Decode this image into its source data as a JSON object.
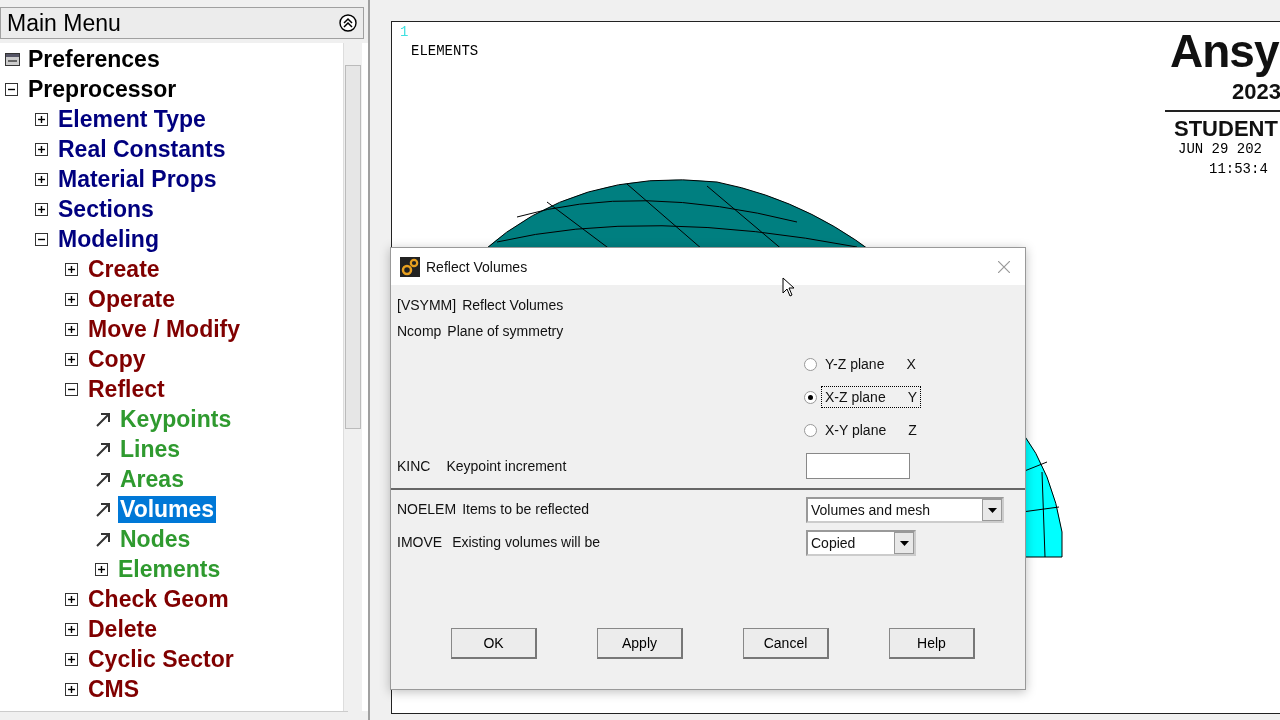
{
  "main_menu": {
    "title": "Main Menu",
    "items": [
      {
        "label": "Preferences",
        "kind": "settings",
        "selected": false
      },
      {
        "label": "Preprocessor",
        "kind": "node",
        "expanded": true,
        "selected": false,
        "children": [
          {
            "label": "Element Type",
            "kind": "node",
            "expanded": false,
            "selected": false
          },
          {
            "label": "Real Constants",
            "kind": "node",
            "expanded": false,
            "selected": false
          },
          {
            "label": "Material Props",
            "kind": "node",
            "expanded": false,
            "selected": false
          },
          {
            "label": "Sections",
            "kind": "node",
            "expanded": false,
            "selected": false
          },
          {
            "label": "Modeling",
            "kind": "node",
            "expanded": true,
            "selected": false,
            "children": [
              {
                "label": "Create",
                "kind": "node",
                "expanded": false,
                "selected": false
              },
              {
                "label": "Operate",
                "kind": "node",
                "expanded": false,
                "selected": false
              },
              {
                "label": "Move / Modify",
                "kind": "node",
                "expanded": false,
                "selected": false
              },
              {
                "label": "Copy",
                "kind": "node",
                "expanded": false,
                "selected": false
              },
              {
                "label": "Reflect",
                "kind": "node",
                "expanded": true,
                "selected": false,
                "children": [
                  {
                    "label": "Keypoints",
                    "kind": "action",
                    "selected": false
                  },
                  {
                    "label": "Lines",
                    "kind": "action",
                    "selected": false
                  },
                  {
                    "label": "Areas",
                    "kind": "action",
                    "selected": false
                  },
                  {
                    "label": "Volumes",
                    "kind": "action",
                    "selected": true
                  },
                  {
                    "label": "Nodes",
                    "kind": "action",
                    "selected": false
                  },
                  {
                    "label": "Elements",
                    "kind": "node",
                    "expanded": false,
                    "selected": false
                  }
                ]
              },
              {
                "label": "Check Geom",
                "kind": "node",
                "expanded": false,
                "selected": false
              },
              {
                "label": "Delete",
                "kind": "node",
                "expanded": false,
                "selected": false
              },
              {
                "label": "Cyclic Sector",
                "kind": "node",
                "expanded": false,
                "selected": false
              },
              {
                "label": "CMS",
                "kind": "node",
                "expanded": false,
                "selected": false
              }
            ]
          }
        ]
      }
    ]
  },
  "graphics": {
    "window_number": "1",
    "label": "ELEMENTS",
    "logo": {
      "brand": "Ansy",
      "version": "2023",
      "edition": "STUDENT"
    },
    "date": "JUN 29 202",
    "time": "11:53:4"
  },
  "dialog": {
    "title": "Reflect Volumes",
    "header": {
      "code": "[VSYMM]",
      "label": "Reflect Volumes"
    },
    "ncomp": {
      "code": "Ncomp",
      "label": "Plane of symmetry",
      "options": [
        {
          "label": "Y-Z plane",
          "axis": "X",
          "selected": false
        },
        {
          "label": "X-Z plane",
          "axis": "Y",
          "selected": true
        },
        {
          "label": "X-Y plane",
          "axis": "Z",
          "selected": false
        }
      ]
    },
    "kinc": {
      "code": "KINC",
      "label": "Keypoint increment"
    },
    "noelem": {
      "code": "NOELEM",
      "label": "Items to be reflected",
      "value": "Volumes and mesh"
    },
    "imove": {
      "code": "IMOVE",
      "label": "Existing volumes will be",
      "value": "Copied"
    },
    "buttons": [
      "OK",
      "Apply",
      "Cancel",
      "Help"
    ]
  }
}
